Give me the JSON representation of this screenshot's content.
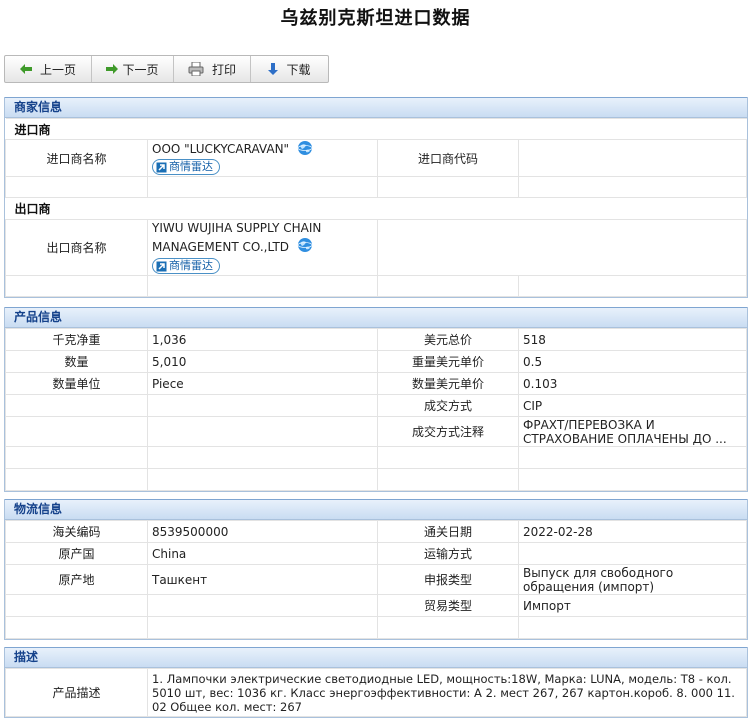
{
  "page": {
    "title": "乌兹别克斯坦进口数据"
  },
  "toolbar": {
    "prev": "上一页",
    "next": "下一页",
    "print": "打印",
    "download": "下载"
  },
  "merchant": {
    "header": "商家信息",
    "importer_section": "进口商",
    "importer_name_label": "进口商名称",
    "importer_name": "OOO \"LUCKYCARAVAN\"",
    "importer_code_label": "进口商代码",
    "radar_label": "商情雷达",
    "exporter_section": "出口商",
    "exporter_name_label": "出口商名称",
    "exporter_name": "YIWU WUJIHA SUPPLY CHAIN MANAGEMENT CO.,LTD"
  },
  "product": {
    "header": "产品信息",
    "weight_label": "千克净重",
    "weight": "1,036",
    "total_usd_label": "美元总价",
    "total_usd": "518",
    "qty_label": "数量",
    "qty": "5,010",
    "weight_unit_price_label": "重量美元单价",
    "weight_unit_price": "0.5",
    "qty_unit_label": "数量单位",
    "qty_unit": "Piece",
    "qty_unit_price_label": "数量美元单价",
    "qty_unit_price": "0.103",
    "deal_label": "成交方式",
    "deal": "CIP",
    "deal_note_label": "成交方式注释",
    "deal_note": "ФРАХТ/ПЕРЕВОЗКА И СТРАХОВАНИЕ ОПЛАЧЕНЫ ДО ..."
  },
  "logistics": {
    "header": "物流信息",
    "hs_label": "海关编码",
    "hs": "8539500000",
    "clear_date_label": "通关日期",
    "clear_date": "2022-02-28",
    "origin_country_label": "原产国",
    "origin_country": "China",
    "transport_label": "运输方式",
    "transport": "",
    "origin_place_label": "原产地",
    "origin_place": "Ташкент",
    "declare_type_label": "申报类型",
    "declare_type": "Выпуск для свободного обращения (импорт)",
    "trade_type_label": "贸易类型",
    "trade_type": "Импорт"
  },
  "description": {
    "header": "描述",
    "label": "产品描述",
    "text": "1. Лампочки электрические светодиодные LED, мощность:18W, Марка: LUNA, модель: T8 - кол. 5010 шт, вес: 1036 кг. Класс энергоэффективности: А 2. мест 267, 267 картон.короб. 8. 000 11. 02 Общее кол. мест: 267"
  }
}
